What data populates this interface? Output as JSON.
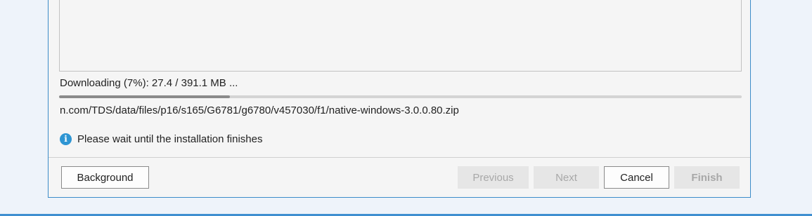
{
  "progress": {
    "status_text": "Downloading (7%): 27.4 / 391.1 MB ...",
    "percent": 7,
    "current_url": "n.com/TDS/data/files/p16/s165/G6781/g6780/v457030/f1/native-windows-3.0.0.80.zip"
  },
  "info": {
    "icon": "info-icon",
    "message": "Please wait until the installation finishes"
  },
  "buttons": {
    "background": "Background",
    "previous": "Previous",
    "next": "Next",
    "cancel": "Cancel",
    "finish": "Finish"
  },
  "colors": {
    "dialog_border": "#3c8cc9",
    "info_icon": "#2e95d3",
    "progress_fill": "#8a8a8a"
  }
}
